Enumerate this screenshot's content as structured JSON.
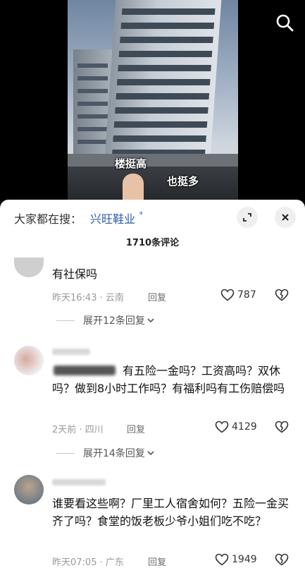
{
  "video": {
    "caption_1": "楼挺高",
    "caption_2": "也挺多",
    "search_icon": "search-icon"
  },
  "panel": {
    "search_prefix": "大家都在搜：",
    "search_keyword": "兴旺鞋业",
    "keyword_icon": "ᵠ",
    "comment_count": "1710条评论",
    "expand_icon": "expand-icon",
    "close_icon": "close-icon"
  },
  "comments": [
    {
      "text": "有社保吗",
      "meta": "昨天16:43 · 云南",
      "reply_label": "回复",
      "likes": "787",
      "expand_label": "展开12条回复"
    },
    {
      "text": "有五险一金吗？工资高吗？双休吗？做到8小时工作吗？有福利吗有工伤赔偿吗",
      "meta": "2天前 · 四川",
      "reply_label": "回复",
      "likes": "4129",
      "expand_label": "展开14条回复"
    },
    {
      "text": "谁要看这些啊？厂里工人宿舍如何？五险一金买齐了吗？食堂的饭老板少爷小姐们吃不吃？",
      "meta": "昨天07:05 · 广东",
      "reply_label": "回复",
      "likes": "1949"
    }
  ]
}
